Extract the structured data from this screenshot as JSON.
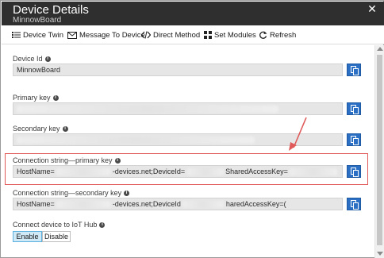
{
  "header": {
    "title": "Device Details",
    "subtitle": "MinnowBoard",
    "close_glyph": "✕"
  },
  "toolbar": {
    "device_twin": "Device Twin",
    "message_to_device": "Message To Device",
    "direct_method": "Direct Method",
    "set_modules": "Set Modules",
    "refresh": "Refresh"
  },
  "fields": {
    "device_id": {
      "label": "Device Id",
      "value": "MinnowBoard"
    },
    "primary_key": {
      "label": "Primary key",
      "value": ""
    },
    "secondary_key": {
      "label": "Secondary key",
      "value": ""
    },
    "conn_primary": {
      "label": "Connection string—primary key",
      "part1": "HostName=",
      "part2": "-devices.net;DeviceId=",
      "part3": "SharedAccessKey="
    },
    "conn_secondary": {
      "label": "Connection string—secondary key",
      "part1": "HostName=",
      "part2": "-devices.net;DeviceId",
      "part3": "haredAccessKey=("
    }
  },
  "iot_hub": {
    "label": "Connect device to IoT Hub",
    "enable": "Enable",
    "disable": "Disable",
    "selected": "Enable"
  },
  "icons": {
    "info": "i",
    "copy": "copy-icon"
  },
  "colors": {
    "header_bg": "#2f2f2f",
    "copy_button": "#2a6fc4",
    "highlight": "#e05a5a",
    "toggle_selected": "#cfe9f7"
  }
}
